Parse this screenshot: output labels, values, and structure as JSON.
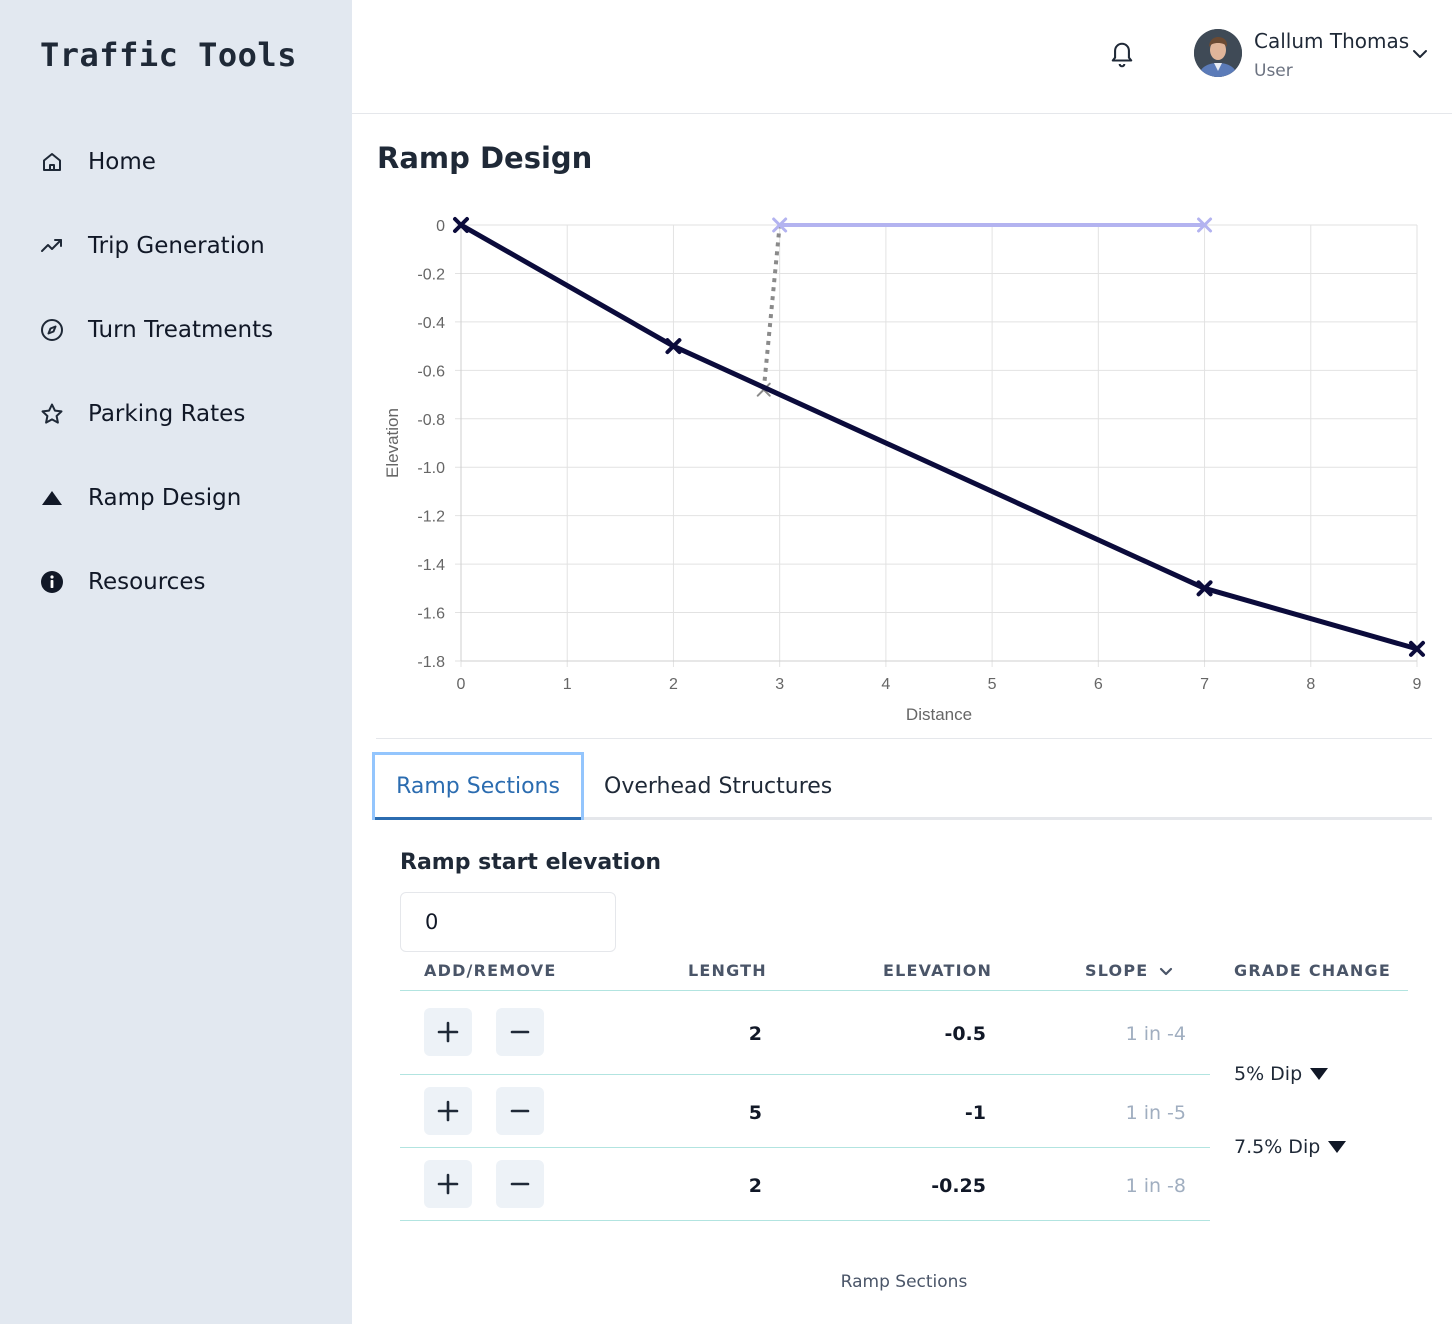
{
  "app": {
    "title": "Traffic Tools"
  },
  "sidebar": {
    "items": [
      {
        "label": "Home",
        "icon": "home-icon"
      },
      {
        "label": "Trip Generation",
        "icon": "trending-up-icon"
      },
      {
        "label": "Turn Treatments",
        "icon": "compass-icon"
      },
      {
        "label": "Parking Rates",
        "icon": "star-icon"
      },
      {
        "label": "Ramp Design",
        "icon": "triangle-icon"
      },
      {
        "label": "Resources",
        "icon": "info-icon"
      }
    ]
  },
  "header": {
    "user_name": "Callum Thomas",
    "user_role": "User",
    "icons": [
      "bell-icon",
      "avatar",
      "chevron-down-icon"
    ]
  },
  "main": {
    "title": "Ramp Design",
    "tabs": [
      {
        "label": "Ramp Sections",
        "active": true
      },
      {
        "label": "Overhead Structures",
        "active": false
      }
    ],
    "start_elevation_label": "Ramp start elevation",
    "start_elevation_value": "0",
    "table": {
      "headers": {
        "add_remove": "ADD/REMOVE",
        "length": "LENGTH",
        "elevation": "ELEVATION",
        "slope": "SLOPE",
        "grade_change": "GRADE CHANGE"
      },
      "rows": [
        {
          "length": "2",
          "elevation": "-0.5",
          "slope": "1 in -4"
        },
        {
          "length": "5",
          "elevation": "-1",
          "slope": "1 in -5"
        },
        {
          "length": "2",
          "elevation": "-0.25",
          "slope": "1 in -8"
        }
      ],
      "grade_changes": [
        "5% Dip",
        "7.5% Dip"
      ],
      "caption": "Ramp Sections"
    }
  },
  "chart_data": {
    "type": "line",
    "xlabel": "Distance",
    "ylabel": "Elevation",
    "xlim": [
      0,
      9
    ],
    "ylim": [
      -1.8,
      0
    ],
    "xticks": [
      0,
      1,
      2,
      3,
      4,
      5,
      6,
      7,
      8,
      9
    ],
    "yticks": [
      0,
      -0.2,
      -0.4,
      -0.6,
      -0.8,
      -1.0,
      -1.2,
      -1.4,
      -1.6,
      -1.8
    ],
    "ytick_labels": [
      "0",
      "-0.2",
      "-0.4",
      "-0.6",
      "-0.8",
      "-1.0",
      "-1.2",
      "-1.4",
      "-1.6",
      "-1.8"
    ],
    "grid": true,
    "series": [
      {
        "x": [
          0,
          2,
          7,
          9
        ],
        "y": [
          0,
          -0.5,
          -1.5,
          -1.75
        ],
        "color": "#0b0b3b",
        "style": "solid",
        "marker": "x"
      },
      {
        "x": [
          3,
          7
        ],
        "y": [
          0,
          0
        ],
        "color": "#b3b3f0",
        "style": "solid",
        "marker": "x"
      },
      {
        "x": [
          2.85,
          3
        ],
        "y": [
          -0.68,
          0
        ],
        "color": "#8a8a8a",
        "style": "dotted",
        "marker": "x-start"
      }
    ]
  },
  "colors": {
    "sidebar_bg": "#e2e8f0",
    "accent": "#2b6cb0",
    "tab_focus": "#93c5fd",
    "row_line": "#b2e4e0"
  }
}
